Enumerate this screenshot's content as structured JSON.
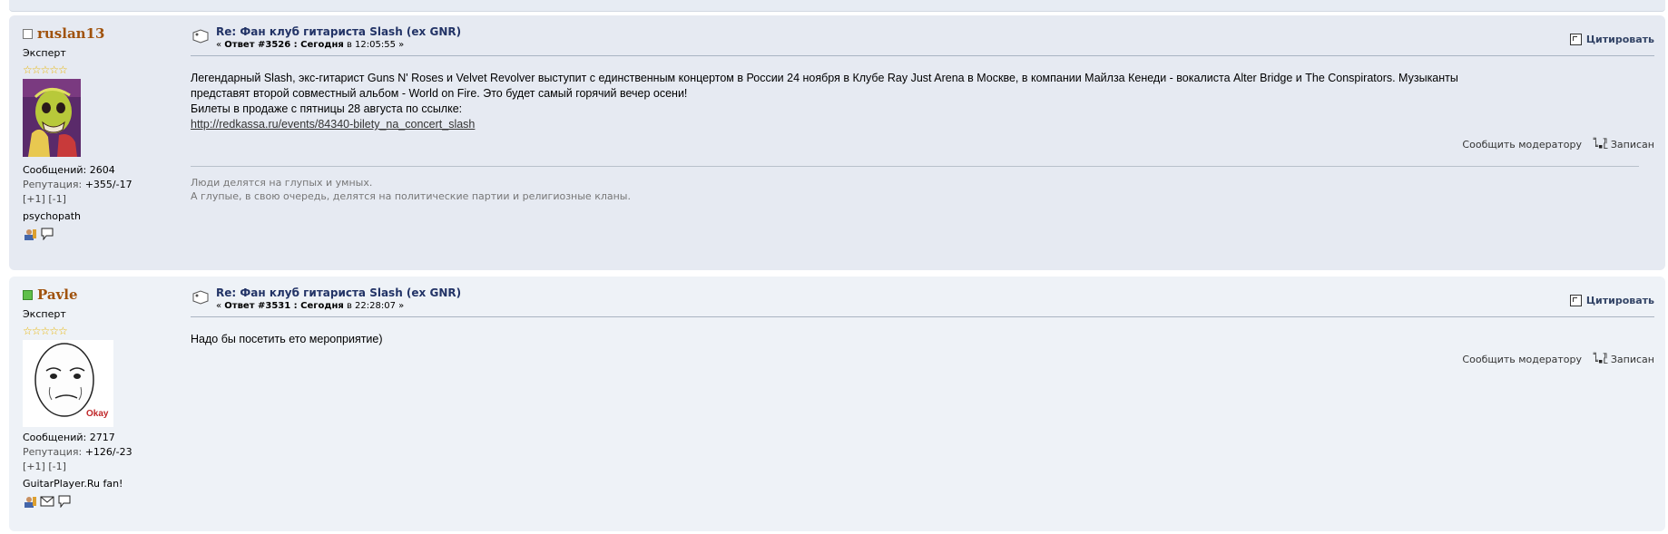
{
  "posts": [
    {
      "username": "ruslan13",
      "online": false,
      "rank": "Эксперт",
      "stars": "☆☆☆☆☆",
      "posts_label": "Сообщений: 2604",
      "rep_label": "Репутация:",
      "rep_value": "+355/-17",
      "rep_plus": "[+1]",
      "rep_minus": "[-1]",
      "personal_text": "psychopath",
      "subject": "Re: Фан клуб гитариста Slash (ex GNR)",
      "reply_prefix": "« ",
      "reply_bold": "Ответ #3526 : Сегодня",
      "reply_suffix": " в 12:05:55 »",
      "quote_label": "Цитировать",
      "message_lines": [
        "Легендарный Slash, экс-гитарист Guns N' Roses и Velvet Revolver выступит с единственным концертом в России 24 ноября в Клубе Ray Just Arena в Москве, в компании Майлза Кенеди - вокалиста Alter Bridge и The Conspirators. Музыканты",
        "представят второй совместный альбом - World on Fire. Это будет самый горячий вечер осени!",
        "Билеты в продаже с пятницы 28 августа по ссылке:"
      ],
      "link": "http://redkassa.ru/events/84340-bilety_na_concert_slash",
      "report_label": "Сообщить модератору",
      "logged_label": "Записан",
      "signature_lines": [
        "Люди делятся на глупых и умных.",
        "А глупые, в свою очередь, делятся на политические партии и религиозные кланы."
      ]
    },
    {
      "username": "Pavle",
      "online": true,
      "rank": "Эксперт",
      "stars": "☆☆☆☆☆",
      "posts_label": "Сообщений: 2717",
      "rep_label": "Репутация:",
      "rep_value": "+126/-23",
      "rep_plus": "[+1]",
      "rep_minus": "[-1]",
      "personal_text": "GuitarPlayer.Ru fan!",
      "avatar_caption": "Okay",
      "subject": "Re: Фан клуб гитариста Slash (ex GNR)",
      "reply_prefix": "« ",
      "reply_bold": "Ответ #3531 : Сегодня",
      "reply_suffix": " в 22:28:07 »",
      "quote_label": "Цитировать",
      "message_lines": [
        "Надо бы посетить ето мероприятие)"
      ],
      "report_label": "Сообщить модератору",
      "logged_label": "Записан"
    }
  ],
  "colors": {
    "username": "#a0520c",
    "subject": "#223366",
    "post1_bg": "#e6eaf2",
    "post2_bg": "#eef2f7",
    "online": "#5fbf4a"
  }
}
